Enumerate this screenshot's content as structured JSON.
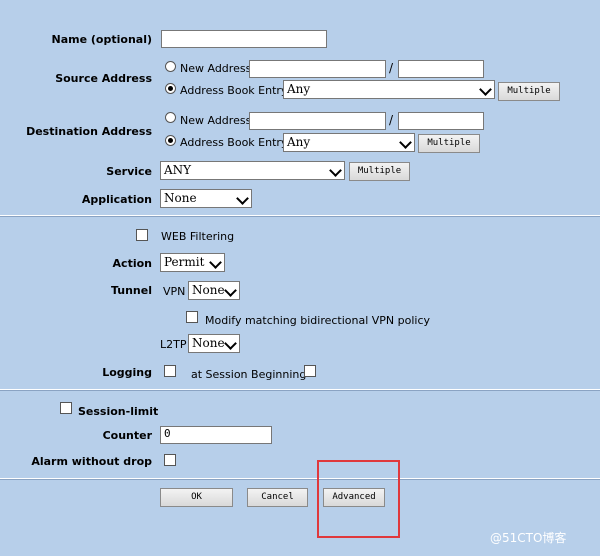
{
  "name": {
    "label": "Name (optional)",
    "value": ""
  },
  "source": {
    "label": "Source Address",
    "new_address_label": "New Address",
    "separator": "/",
    "book_label": "Address Book Entry",
    "book_value": "Any",
    "multiple_label": "Multiple"
  },
  "destination": {
    "label": "Destination Address",
    "new_address_label": "New Address",
    "separator": "/",
    "book_label": "Address Book Entry",
    "book_value": "Any",
    "multiple_label": "Multiple"
  },
  "service": {
    "label": "Service",
    "value": "ANY",
    "multiple_label": "Multiple"
  },
  "application": {
    "label": "Application",
    "value": "None"
  },
  "web_filtering": {
    "label": "WEB Filtering"
  },
  "action": {
    "label": "Action",
    "value": "Permit"
  },
  "tunnel": {
    "label": "Tunnel",
    "vpn_label": "VPN",
    "vpn_value": "None",
    "modify_label": "Modify matching bidirectional VPN policy",
    "l2tp_label": "L2TP",
    "l2tp_value": "None"
  },
  "logging": {
    "label": "Logging",
    "session_label": "at Session Beginning"
  },
  "session_limit": {
    "label": "Session-limit"
  },
  "counter": {
    "label": "Counter",
    "value": "0"
  },
  "alarm": {
    "label": "Alarm without drop"
  },
  "buttons": {
    "ok": "OK",
    "cancel": "Cancel",
    "advanced": "Advanced"
  },
  "watermark": "@51CTO博客",
  "colors": {
    "background": "#b7cfea",
    "highlight": "#e0383c"
  }
}
